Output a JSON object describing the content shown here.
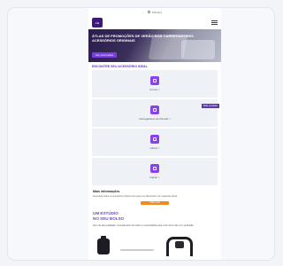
{
  "browser": {
    "url": "Talk Ezy"
  },
  "header": {
    "logo_text": "LG"
  },
  "hero": {
    "title": "ÁTLAS DE PROMOÇÕES DE VERÃO NOS CARREGADORES ACESSÓRIOS ORIGINAIS",
    "button_label": "Ver promoções"
  },
  "categories": {
    "title": "ENCONTRE SEU ACESSÓRIO IDEAL",
    "items": [
      {
        "label": "Fones >"
      },
      {
        "label": "Carregadores de Parede >",
        "tag": "Mais vendidos"
      },
      {
        "label": "Cabos >"
      },
      {
        "label": "Capas >"
      }
    ]
  },
  "info": {
    "title": "Mais informações",
    "text": "Descubra todos os acessórios disponíveis para seu dispositivo com garantia oficial.",
    "button_label": "Saiba mais"
  },
  "promo": {
    "title_line1": "UM ESTÚDIO",
    "title_line2": "NO SEU BOLSO",
    "text": "Som de alta qualidade, cancelamento de ruído e conectividade para você ouvir tudo com perfeição."
  },
  "colors": {
    "accent": "#7a3ff0",
    "brand": "#3d1a78",
    "cta": "#f28a1a"
  }
}
